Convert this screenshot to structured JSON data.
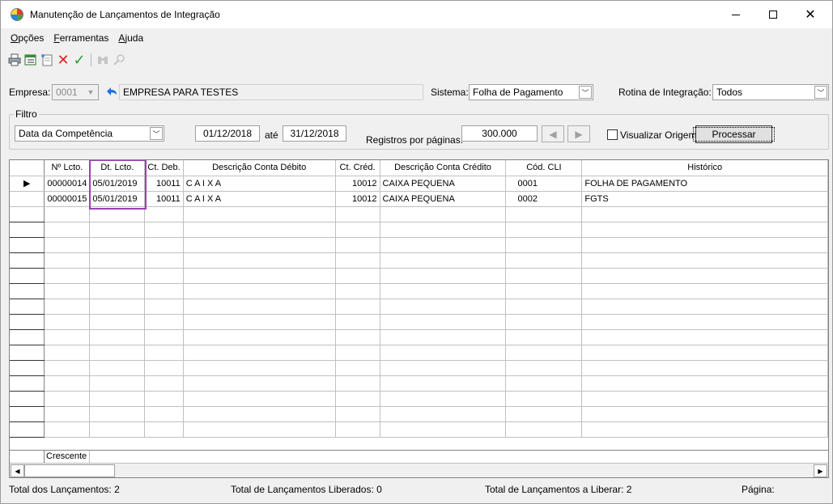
{
  "window": {
    "title": "Manutenção de Lançamentos de Integração"
  },
  "menu": [
    {
      "label": "Opções",
      "mnemonic_index": 0
    },
    {
      "label": "Ferramentas",
      "mnemonic_index": 0
    },
    {
      "label": "Ajuda",
      "mnemonic_index": 0
    }
  ],
  "toolbar": {
    "icons": [
      "print-icon",
      "export-icon",
      "new-document-icon",
      "cancel-icon",
      "confirm-icon",
      "binoculars-icon",
      "search-icon"
    ]
  },
  "empresa": {
    "label": "Empresa:",
    "code": "0001",
    "name": "EMPRESA PARA TESTES"
  },
  "sistema": {
    "label": "Sistema:",
    "value": "Folha de Pagamento"
  },
  "rotina": {
    "label": "Rotina de Integração:",
    "value": "Todos"
  },
  "filtro": {
    "legend": "Filtro",
    "type": "Data da Competência",
    "date_from": "01/12/2018",
    "ate_label": "até",
    "date_to": "31/12/2018",
    "registros_label": "Registros por páginas:",
    "registros_value": "300.000",
    "visualizar_label": "Visualizar Origem",
    "processar_label": "Processar"
  },
  "grid": {
    "columns": [
      "Nº Lcto.",
      "Dt. Lcto.",
      "Ct. Deb.",
      "Descrição Conta Débito",
      "Ct. Créd.",
      "Descrição Conta Crédito",
      "Cód. CLI",
      "Histórico"
    ],
    "rows": [
      [
        "00000014",
        "05/01/2019",
        "10011",
        "C A I X A",
        "10012",
        "CAIXA PEQUENA",
        "0001",
        "FOLHA DE PAGAMENTO"
      ],
      [
        "00000015",
        "05/01/2019",
        "10011",
        "C A I X A",
        "10012",
        "CAIXA PEQUENA",
        "0002",
        "FGTS"
      ]
    ],
    "footer_label": "Crescente"
  },
  "status": {
    "total": "Total dos Lançamentos: 2",
    "liberados": "Total de Lançamentos Liberados: 0",
    "a_liberar": "Total de Lançamentos a Liberar: 2",
    "pagina": "Página:"
  },
  "colors": {
    "highlight": "#9c3fb5",
    "ok": "#2e9b2e",
    "cancel": "#e02020",
    "undo": "#1e6fd9"
  }
}
